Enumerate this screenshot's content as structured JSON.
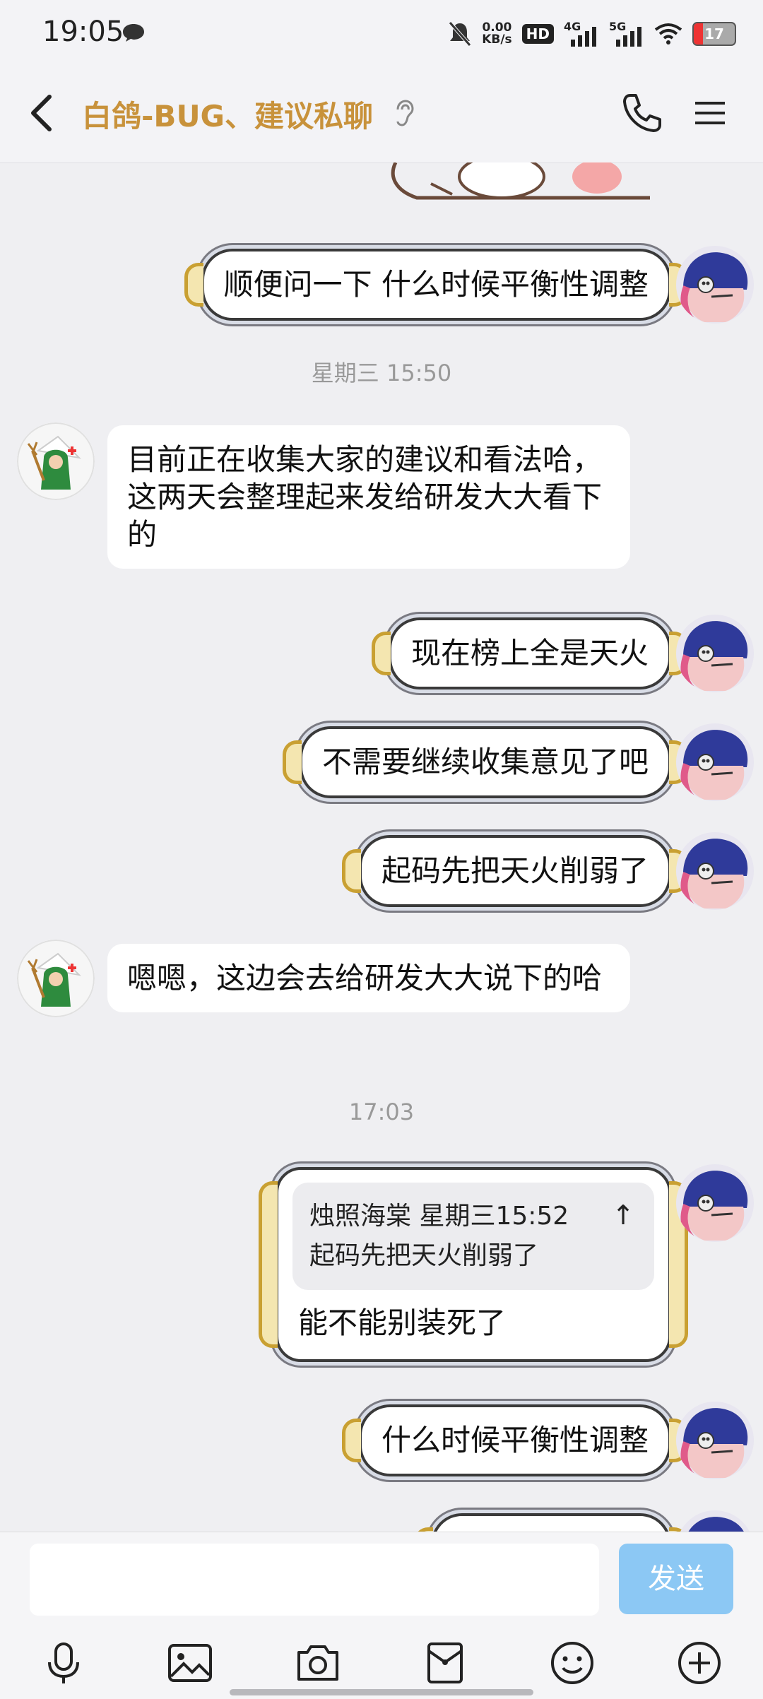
{
  "status_bar": {
    "time": "19:05",
    "net_speed_value": "0.00",
    "net_speed_unit": "KB/s",
    "hd_label": "HD",
    "sim1": "4G",
    "sim2": "5G",
    "battery": "17"
  },
  "header": {
    "title": "白鸽-BUG、建议私聊"
  },
  "messages": [
    {
      "side": "right",
      "text": "顺便问一下 什么时候平衡性调整"
    },
    {
      "side": "left",
      "text": "目前正在收集大家的建议和看法哈，这两天会整理起来发给研发大大看下的"
    },
    {
      "side": "right",
      "text": "现在榜上全是天火"
    },
    {
      "side": "right",
      "text": "不需要继续收集意见了吧"
    },
    {
      "side": "right",
      "text": "起码先把天火削弱了"
    },
    {
      "side": "left",
      "text": "嗯嗯，这边会去给研发大大说下的哈"
    },
    {
      "side": "right",
      "quote_header": "烛照海棠 星期三15:52",
      "quote_text": "起码先把天火削弱了",
      "text": "能不能别装死了"
    },
    {
      "side": "right",
      "text": "什么时候平衡性调整"
    }
  ],
  "timestamps": [
    "星期三 15:50",
    "17:03"
  ],
  "input_bar": {
    "placeholder": "",
    "send_label": "发送",
    "accent_color": "#8cc8f4"
  },
  "toolbar_icons": [
    "microphone-icon",
    "image-icon",
    "camera-icon",
    "red-packet-icon",
    "emoji-icon",
    "plus-icon"
  ]
}
